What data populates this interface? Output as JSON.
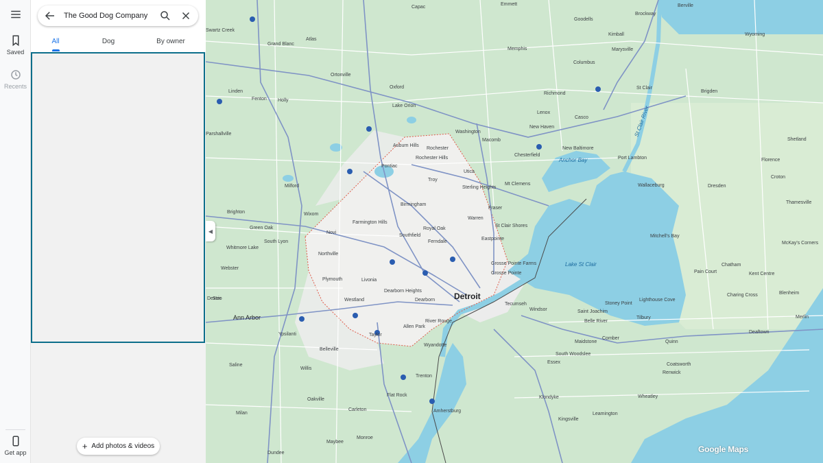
{
  "sidebar": {
    "saved_label": "Saved",
    "recents_label": "Recents",
    "get_app_label": "Get app"
  },
  "search": {
    "value": "The Good Dog Company"
  },
  "tabs": [
    {
      "label": "All",
      "active": true
    },
    {
      "label": "Dog",
      "active": false
    },
    {
      "label": "By owner",
      "active": false
    }
  ],
  "panel": {
    "add_photos_label": "Add photos & videos"
  },
  "map": {
    "attribution": "Google Maps",
    "colors": {
      "land": "#cfe7cf",
      "water": "#8dcfe4",
      "urban": "#f0f0ee",
      "highway": "#7f93c5",
      "road": "#ffffff",
      "boundary": "#e05a4a"
    },
    "water_labels": [
      "Anchor Bay",
      "Lake St Clair",
      "St Clair River"
    ],
    "places": {
      "major": [
        "Detroit",
        "Ann Arbor"
      ],
      "cities": [
        "Auburn Hills",
        "Rochester",
        "Rochester Hills",
        "Pontiac",
        "Troy",
        "Birmingham",
        "Royal Oak",
        "Southfield",
        "Ferndale",
        "Warren",
        "Farmington Hills",
        "Novi",
        "Livonia",
        "Northville",
        "Dearborn",
        "Dearborn Heights",
        "Westland",
        "Sterling Heights",
        "Utica",
        "Mt Clemens",
        "St Clair Shores",
        "Eastpointe",
        "Fraser",
        "Grosse Pointe Farms",
        "Grosse Pointe",
        "River Rouge",
        "Allen Park",
        "Taylor",
        "Wyandotte",
        "Tecumseh",
        "Windsor",
        "Amherstburg"
      ],
      "towns": [
        "Capac",
        "Goodells",
        "Kimball",
        "Wyoming",
        "Atlas",
        "Grand Blanc",
        "Holly",
        "Fenton",
        "Linden",
        "Ortonville",
        "Oxford",
        "Lake Orion",
        "Washington",
        "Macomb",
        "New Haven",
        "New Baltimore",
        "Chesterfield",
        "Richmond",
        "Lenox",
        "Casco",
        "Marysville",
        "St Clair",
        "Columbus",
        "Memphis",
        "Port Lambton",
        "Wallaceburg",
        "Dresden",
        "Brigden",
        "Florence",
        "Shetland",
        "Croton",
        "Thamesville",
        "Mitchell's Bay",
        "McKay's Corners",
        "Chatham",
        "Pain Court",
        "Kent Centre",
        "Charing Cross",
        "Blenheim",
        "Merlin",
        "Deaftown",
        "Quinn",
        "Coatsworth",
        "Renwick",
        "Wheatley",
        "Leamington",
        "Kingsville",
        "Klondyke",
        "Essex",
        "Comber",
        "South Woodslee",
        "Maidstone",
        "Belle River",
        "Lighthouse Cove",
        "Stoney Point",
        "Saint Joachim",
        "Tilbury",
        "Parshallville",
        "Milford",
        "Wixom",
        "Brighton",
        "Green Oak",
        "South Lyon",
        "Whitmore Lake",
        "Webster",
        "Plymouth",
        "Dexter",
        "Scio",
        "Ypsilanti",
        "Belleville",
        "Saline",
        "Willis",
        "Oakville",
        "Carleton",
        "Flat Rock",
        "Trenton",
        "Monroe",
        "Milan",
        "Dundee",
        "Maybee",
        "Emmett",
        "Brockway",
        "Berville",
        "Swartz Creek"
      ]
    }
  }
}
